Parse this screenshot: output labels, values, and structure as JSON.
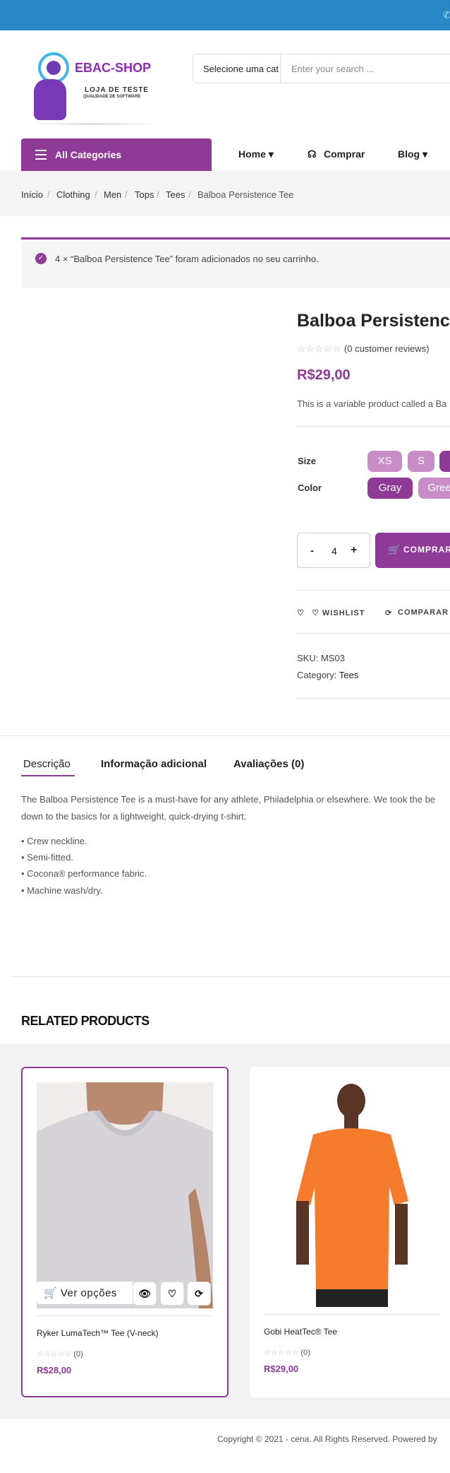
{
  "store": {
    "name": "EBAC-SHOP",
    "tagline": "LOJA DE TESTE",
    "tagline_sub": "QUALIDADE DE SOFTWARE"
  },
  "search": {
    "category_label": "Selecione uma cat",
    "placeholder": "Enter your search ..."
  },
  "nav": {
    "all_categories": "All Categories",
    "items": [
      {
        "label": "Home ▾"
      },
      {
        "label": "Comprar"
      },
      {
        "label": "Blog ▾"
      }
    ]
  },
  "breadcrumb": [
    "Início",
    "Clothing",
    "Men",
    "Tops",
    "Tees",
    "Balboa Persistence Tee"
  ],
  "notice": {
    "text": "4 × “Balboa Persistence Tee” foram adicionados no seu carrinho."
  },
  "product": {
    "title": "Balboa Persistence",
    "reviews": "(0 customer reviews)",
    "price": "R$29,00",
    "short_description": "This is a variable product called a Ba",
    "size_label": "Size",
    "sizes": [
      "XS",
      "S",
      ""
    ],
    "color_label": "Color",
    "colors": [
      "Gray",
      "Gree"
    ],
    "quantity": "4",
    "buy_label": "COMPRAR",
    "wishlist_label": "♡ WISHLIST",
    "compare_label": "COMPARAR",
    "sku_label": "SKU:",
    "sku": "MS03",
    "category_label": "Category:",
    "category": "Tees"
  },
  "tabs": [
    "Descrição",
    "Informação adicional",
    "Avaliações (0)"
  ],
  "description": {
    "paragraph_1": "The Balboa Persistence Tee is a must-have for any athlete, Philadelphia or elsewhere. We took the be",
    "paragraph_2": "down to the basics for a lightweight, quick-drying t-shirt.",
    "bullets": [
      "• Crew neckline.",
      "• Semi-fitted.",
      "• Cocona® performance fabric.",
      "• Machine wash/dry."
    ]
  },
  "related": {
    "title": "RELATED PRODUCTS",
    "products": [
      {
        "name": "Ryker LumaTech™ Tee (V-neck)",
        "reviews": "(0)",
        "price": "R$28,00",
        "options_label": "Ver opções"
      },
      {
        "name": "Gobi HeatTec® Tee",
        "reviews": "(0)",
        "price": "R$29,00"
      }
    ]
  },
  "footer": {
    "copyright": "Copyright © 2021 - cena. All Rights Reserved. Powered by"
  },
  "colors": {
    "accent": "#8e3a96",
    "topbar": "#2b86c5",
    "swatch": "#c88cc6"
  }
}
